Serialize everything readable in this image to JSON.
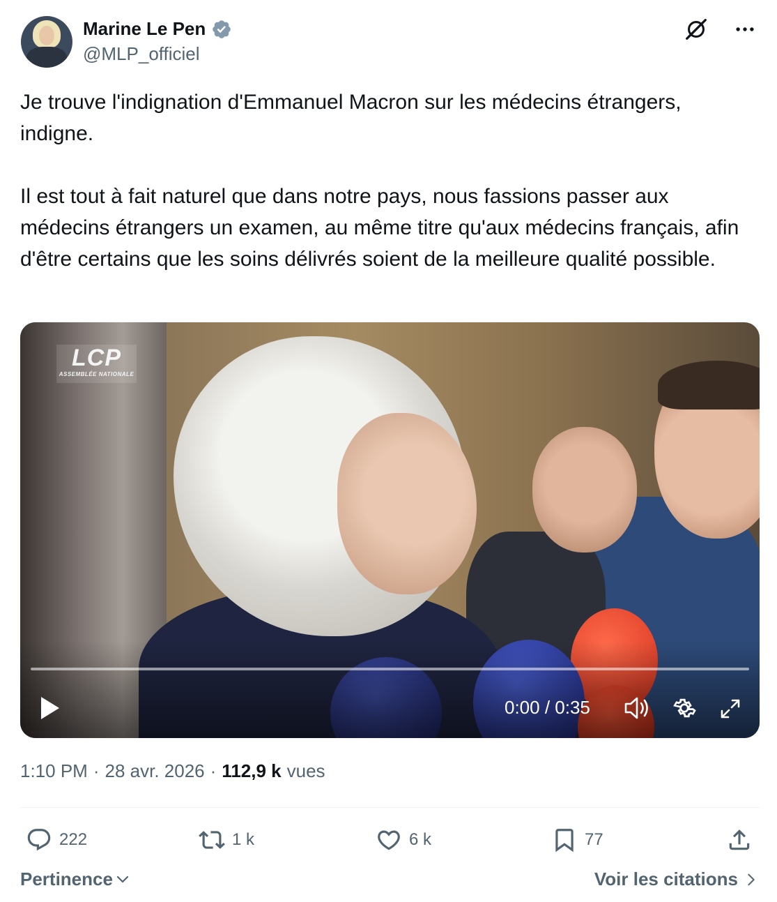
{
  "author": {
    "name": "Marine Le Pen",
    "handle": "@MLP_officiel",
    "verified": true
  },
  "header_icons": [
    "grok-icon",
    "more-icon"
  ],
  "tweet": {
    "text": "Je trouve l'indignation d'Emmanuel Macron sur les médecins étrangers, indigne.\n\nIl est tout à fait naturel que dans notre pays, nous fassions passer aux médecins étrangers un examen, au même titre qu'aux médecins français, afin d'être certains que les soins délivrés soient de la meilleure qualité possible."
  },
  "video": {
    "watermark_main": "LCP",
    "watermark_sub": "ASSEMBLÉE NATIONALE",
    "time_display": "0:00 / 0:35",
    "progress": 0.0
  },
  "meta": {
    "time": "1:10 PM",
    "date": "28 avr. 2026",
    "separator": "·",
    "views_count": "112,9 k",
    "views_label": "vues"
  },
  "actions": {
    "replies": "222",
    "reposts": "1 k",
    "likes": "6 k",
    "bookmarks": "77"
  },
  "footer": {
    "sort_label": "Pertinence",
    "quotes_label": "Voir les citations"
  },
  "colors": {
    "text": "#0f1419",
    "secondary": "#536471",
    "verified": "#829aab",
    "divider": "#eff3f4"
  }
}
